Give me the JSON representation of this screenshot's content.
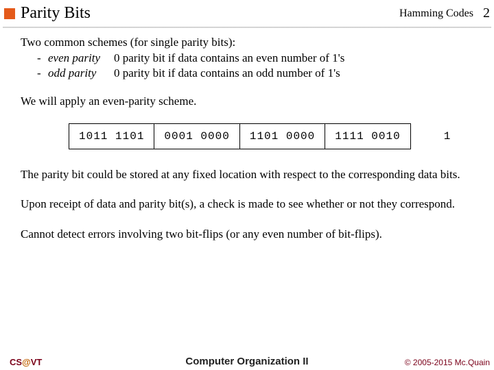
{
  "header": {
    "title": "Parity Bits",
    "topic": "Hamming Codes",
    "page": "2"
  },
  "content": {
    "schemes_intro": "Two common schemes (for single parity bits):",
    "schemes": [
      {
        "dash": "-",
        "name": "even parity",
        "desc": "0 parity bit if data contains an even number of 1's"
      },
      {
        "dash": "-",
        "name": "odd parity",
        "desc": "0 parity bit if data contains an odd number of 1's"
      }
    ],
    "apply": "We will apply an even-parity scheme.",
    "bits": [
      "1011 1101",
      "0001 0000",
      "1101 0000",
      "1111 0010"
    ],
    "parity_output": "1",
    "p_storage": "The parity bit could be stored at any fixed location with respect to the corresponding data bits.",
    "p_receipt": "Upon receipt of data and parity bit(s), a check is made to see whether or not they correspond.",
    "p_limit": "Cannot detect errors involving two bit-flips (or any even number of bit-flips)."
  },
  "footer": {
    "left_pre": "CS",
    "left_at": "@",
    "left_post": "VT",
    "center": "Computer Organization II",
    "right": "© 2005-2015 Mc.Quain"
  }
}
